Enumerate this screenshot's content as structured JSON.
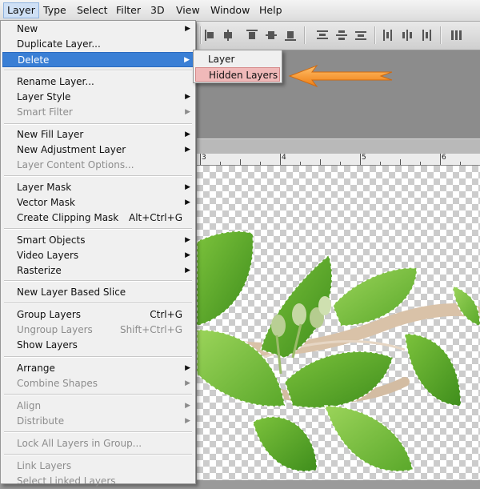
{
  "menubar": {
    "items": [
      "Layer",
      "Type",
      "Select",
      "Filter",
      "3D",
      "View",
      "Window",
      "Help"
    ]
  },
  "menu": {
    "items": [
      {
        "label": "New",
        "shortcut": "",
        "submenu": true,
        "disabled": false,
        "highlighted": false
      },
      {
        "label": "Duplicate Layer...",
        "shortcut": "",
        "submenu": false,
        "disabled": false,
        "highlighted": false
      },
      {
        "label": "Delete",
        "shortcut": "",
        "submenu": true,
        "disabled": false,
        "highlighted": true
      },
      {
        "label": "Rename Layer...",
        "shortcut": "",
        "submenu": false,
        "disabled": false,
        "highlighted": false
      },
      {
        "label": "Layer Style",
        "shortcut": "",
        "submenu": true,
        "disabled": false,
        "highlighted": false
      },
      {
        "label": "Smart Filter",
        "shortcut": "",
        "submenu": true,
        "disabled": true,
        "highlighted": false
      },
      {
        "label": "New Fill Layer",
        "shortcut": "",
        "submenu": true,
        "disabled": false,
        "highlighted": false
      },
      {
        "label": "New Adjustment Layer",
        "shortcut": "",
        "submenu": true,
        "disabled": false,
        "highlighted": false
      },
      {
        "label": "Layer Content Options...",
        "shortcut": "",
        "submenu": false,
        "disabled": true,
        "highlighted": false
      },
      {
        "label": "Layer Mask",
        "shortcut": "",
        "submenu": true,
        "disabled": false,
        "highlighted": false
      },
      {
        "label": "Vector Mask",
        "shortcut": "",
        "submenu": true,
        "disabled": false,
        "highlighted": false
      },
      {
        "label": "Create Clipping Mask",
        "shortcut": "Alt+Ctrl+G",
        "submenu": false,
        "disabled": false,
        "highlighted": false
      },
      {
        "label": "Smart Objects",
        "shortcut": "",
        "submenu": true,
        "disabled": false,
        "highlighted": false
      },
      {
        "label": "Video Layers",
        "shortcut": "",
        "submenu": true,
        "disabled": false,
        "highlighted": false
      },
      {
        "label": "Rasterize",
        "shortcut": "",
        "submenu": true,
        "disabled": false,
        "highlighted": false
      },
      {
        "label": "New Layer Based Slice",
        "shortcut": "",
        "submenu": false,
        "disabled": false,
        "highlighted": false
      },
      {
        "label": "Group Layers",
        "shortcut": "Ctrl+G",
        "submenu": false,
        "disabled": false,
        "highlighted": false
      },
      {
        "label": "Ungroup Layers",
        "shortcut": "Shift+Ctrl+G",
        "submenu": false,
        "disabled": true,
        "highlighted": false
      },
      {
        "label": "Show Layers",
        "shortcut": "",
        "submenu": false,
        "disabled": false,
        "highlighted": false
      },
      {
        "label": "Arrange",
        "shortcut": "",
        "submenu": true,
        "disabled": false,
        "highlighted": false
      },
      {
        "label": "Combine Shapes",
        "shortcut": "",
        "submenu": true,
        "disabled": true,
        "highlighted": false
      },
      {
        "label": "Align",
        "shortcut": "",
        "submenu": true,
        "disabled": true,
        "highlighted": false
      },
      {
        "label": "Distribute",
        "shortcut": "",
        "submenu": true,
        "disabled": true,
        "highlighted": false
      },
      {
        "label": "Lock All Layers in Group...",
        "shortcut": "",
        "submenu": false,
        "disabled": true,
        "highlighted": false
      },
      {
        "label": "Link Layers",
        "shortcut": "",
        "submenu": false,
        "disabled": true,
        "highlighted": false
      },
      {
        "label": "Select Linked Layers",
        "shortcut": "",
        "submenu": false,
        "disabled": true,
        "highlighted": false
      }
    ]
  },
  "submenu": {
    "items": [
      {
        "label": "Layer",
        "highlighted": false
      },
      {
        "label": "Hidden Layers",
        "highlighted": true
      }
    ]
  },
  "ruler": {
    "labels": [
      "3",
      "4",
      "5",
      "6"
    ]
  },
  "colors": {
    "menu_highlight": "#3a7fd5",
    "submenu_highlight": "#f0b9b9",
    "callout_arrow": "#f28a1c",
    "leaf_green": "#5aa82a"
  },
  "icons": {
    "callout": "orange-arrow-icon"
  }
}
